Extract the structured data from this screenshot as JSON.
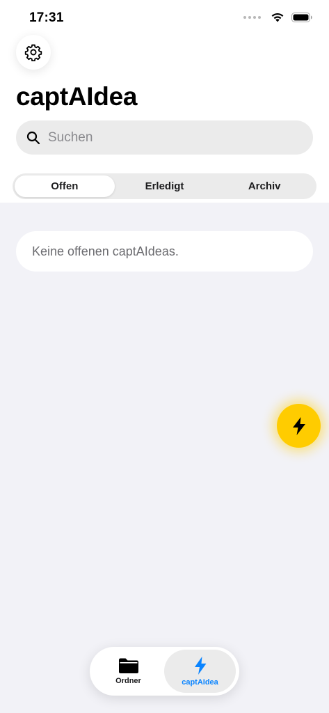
{
  "status_bar": {
    "time": "17:31"
  },
  "header": {
    "title": "captAIdea"
  },
  "search": {
    "placeholder": "Suchen"
  },
  "segments": [
    {
      "label": "Offen",
      "selected": true
    },
    {
      "label": "Erledigt",
      "selected": false
    },
    {
      "label": "Archiv",
      "selected": false
    }
  ],
  "empty_state": {
    "text": "Keine offenen captAIdeas."
  },
  "fab": {
    "icon": "bolt-icon",
    "color": "#ffcc00"
  },
  "tabbar": {
    "items": [
      {
        "label": "Ordner",
        "icon": "folder-icon",
        "selected": false
      },
      {
        "label": "captAIdea",
        "icon": "bolt-icon",
        "selected": true
      }
    ],
    "accent": "#0a84ff"
  }
}
